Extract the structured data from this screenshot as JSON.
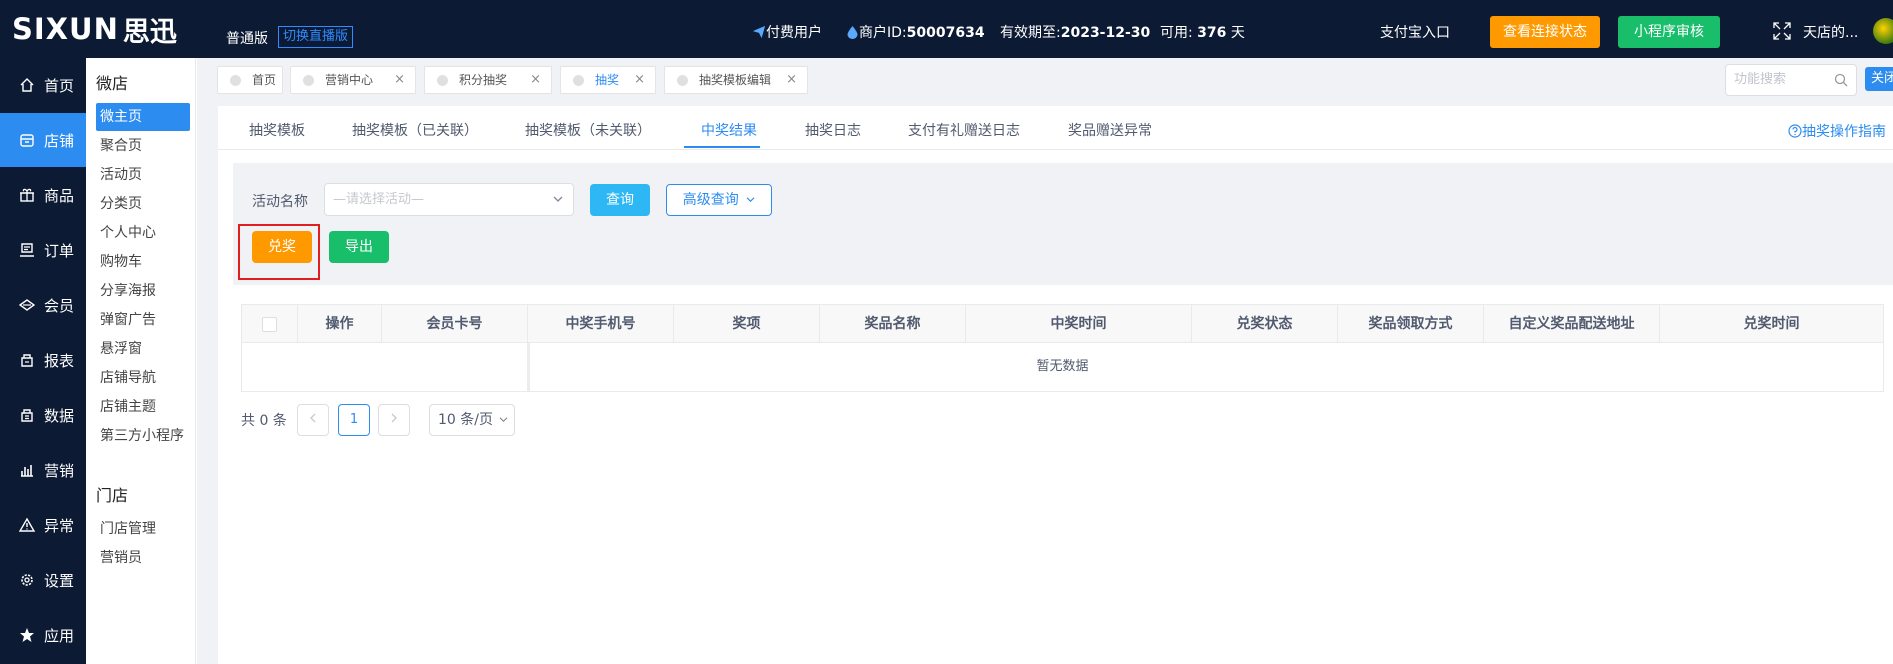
{
  "header": {
    "logo_text": "SIXUN",
    "logo_cn": "思迅",
    "edition": "普通版",
    "switch_label": "切换直播版",
    "paid_user": "付费用户",
    "merchant_prefix": "商户ID:",
    "merchant_id": "50007634",
    "expiry_prefix": "有效期至:",
    "expiry_date": "2023-12-30",
    "available_prefix": "可用:",
    "available_days": "376",
    "available_unit": "天",
    "alipay_entry": "支付宝入口",
    "connection_btn": "查看连接状态",
    "miniprogram_btn": "小程序审核",
    "store_name": "天店的..."
  },
  "mainnav": [
    {
      "label": "首页",
      "icon": "home-icon"
    },
    {
      "label": "店铺",
      "icon": "store-icon",
      "active": true
    },
    {
      "label": "商品",
      "icon": "gift-icon"
    },
    {
      "label": "订单",
      "icon": "order-icon"
    },
    {
      "label": "会员",
      "icon": "member-icon"
    },
    {
      "label": "报表",
      "icon": "report-icon"
    },
    {
      "label": "数据",
      "icon": "data-icon"
    },
    {
      "label": "营销",
      "icon": "marketing-icon"
    },
    {
      "label": "异常",
      "icon": "warning-icon"
    },
    {
      "label": "设置",
      "icon": "gear-icon"
    },
    {
      "label": "应用",
      "icon": "star-icon"
    }
  ],
  "subnav": {
    "section1_title": "微店",
    "section1_items": [
      "微主页",
      "聚合页",
      "活动页",
      "分类页",
      "个人中心",
      "购物车",
      "分享海报",
      "弹窗广告",
      "悬浮窗",
      "店铺导航",
      "店铺主题",
      "第三方小程序"
    ],
    "section2_title": "门店",
    "section2_items": [
      "门店管理",
      "营销员"
    ]
  },
  "tabs": [
    {
      "label": "首页",
      "closable": false
    },
    {
      "label": "营销中心",
      "closable": true
    },
    {
      "label": "积分抽奖",
      "closable": true
    },
    {
      "label": "抽奖",
      "closable": true,
      "active": true
    },
    {
      "label": "抽奖模板编辑",
      "closable": true
    }
  ],
  "func_search_placeholder": "功能搜索",
  "close_label": "关闭",
  "subtabs": [
    "抽奖模板",
    "抽奖模板（已关联）",
    "抽奖模板（未关联）",
    "中奖结果",
    "抽奖日志",
    "支付有礼赠送日志",
    "奖品赠送异常"
  ],
  "active_subtab": "中奖结果",
  "guide_link": "抽奖操作指南",
  "filter": {
    "label": "活动名称",
    "placeholder": "—请选择活动—",
    "query_btn": "查询",
    "advanced_btn": "高级查询"
  },
  "actions": {
    "redeem_btn": "兑奖",
    "export_btn": "导出"
  },
  "table": {
    "columns": [
      "操作",
      "会员卡号",
      "中奖手机号",
      "奖项",
      "奖品名称",
      "中奖时间",
      "兑奖状态",
      "奖品领取方式",
      "自定义奖品配送地址",
      "兑奖时间"
    ],
    "empty_text": "暂无数据"
  },
  "pagination": {
    "total": "共 0 条",
    "current_page": "1",
    "page_size": "10 条/页"
  }
}
